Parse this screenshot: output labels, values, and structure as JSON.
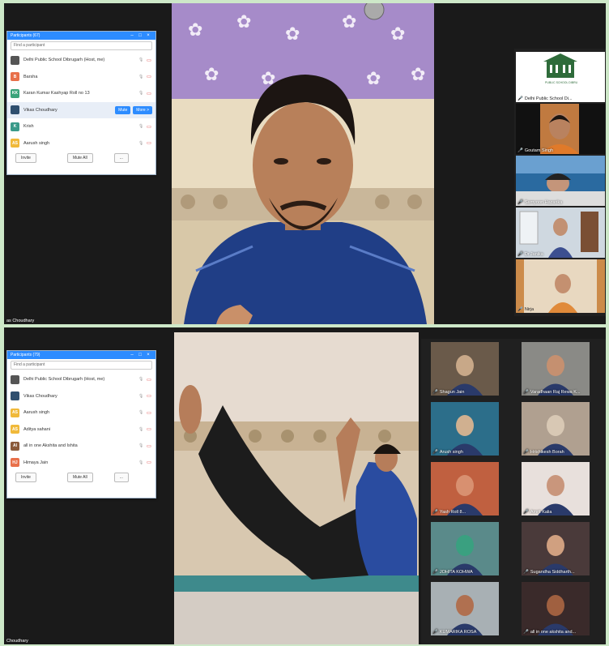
{
  "screenshot1": {
    "panel": {
      "title": "Participants (67)",
      "search_placeholder": "Find a participant",
      "participants": [
        {
          "initials": "",
          "name": "Delhi Public School Dibrugarh (Host, me)",
          "color": "#555555"
        },
        {
          "initials": "B",
          "name": "Barsha",
          "color": "#e8704a"
        },
        {
          "initials": "KK",
          "name": "Karan Kumar Kashyap Roll no 13",
          "color": "#3aa37a"
        },
        {
          "initials": "",
          "name": "Vikas Choudhary",
          "color": "#2f4f6f"
        },
        {
          "initials": "K",
          "name": "Krish",
          "color": "#3a9a8a"
        },
        {
          "initials": "AS",
          "name": "Aarush singh",
          "color": "#f0b93a"
        }
      ],
      "mute_label": "Mute",
      "more_label": "More >",
      "invite_label": "Invite",
      "mute_all_label": "Mute All",
      "more_icon_label": "..."
    },
    "main_name": "as Choudhary",
    "gallery": [
      {
        "name": "Delhi Public School Di..."
      },
      {
        "name": "Goutam Singh"
      },
      {
        "name": "Samyoon Hazarika"
      },
      {
        "name": "Dr.Janika"
      },
      {
        "name": "Nirja"
      }
    ],
    "logo_text": "PUBLIC SCHOOL DIBRU"
  },
  "screenshot2": {
    "panel": {
      "title": "Participants (79)",
      "search_placeholder": "Find a participant",
      "participants": [
        {
          "initials": "",
          "name": "Delhi Public School Dibrugarh (Host, me)",
          "color": "#555555"
        },
        {
          "initials": "",
          "name": "Vikas Choudhary",
          "color": "#2f4f6f"
        },
        {
          "initials": "AS",
          "name": "Aarush singh",
          "color": "#f0b93a"
        },
        {
          "initials": "AS",
          "name": "Aditya sahani",
          "color": "#f0b93a"
        },
        {
          "initials": "AI",
          "name": "all in one Akshita and Ishita",
          "color": "#8a5a3a"
        },
        {
          "initials": "HJ",
          "name": "Himaya Jain",
          "color": "#e8704a"
        }
      ],
      "invite_label": "Invite",
      "mute_all_label": "Mute All",
      "more_icon_label": "..."
    },
    "main_name": "Choudhary",
    "gallery": [
      {
        "name": "Shagun Jain"
      },
      {
        "name": "Varadhaan Raj Rewa K..."
      },
      {
        "name": "Arush singh"
      },
      {
        "name": "Hrishikesh Borah"
      },
      {
        "name": "Yash Roll 8..."
      },
      {
        "name": "Amrit Kalia"
      },
      {
        "name": "JOHITA KOHWA"
      },
      {
        "name": "Sugandha Siddharth..."
      },
      {
        "name": "KUMARIKA ROSA"
      },
      {
        "name": "all in one akshita and..."
      }
    ]
  }
}
